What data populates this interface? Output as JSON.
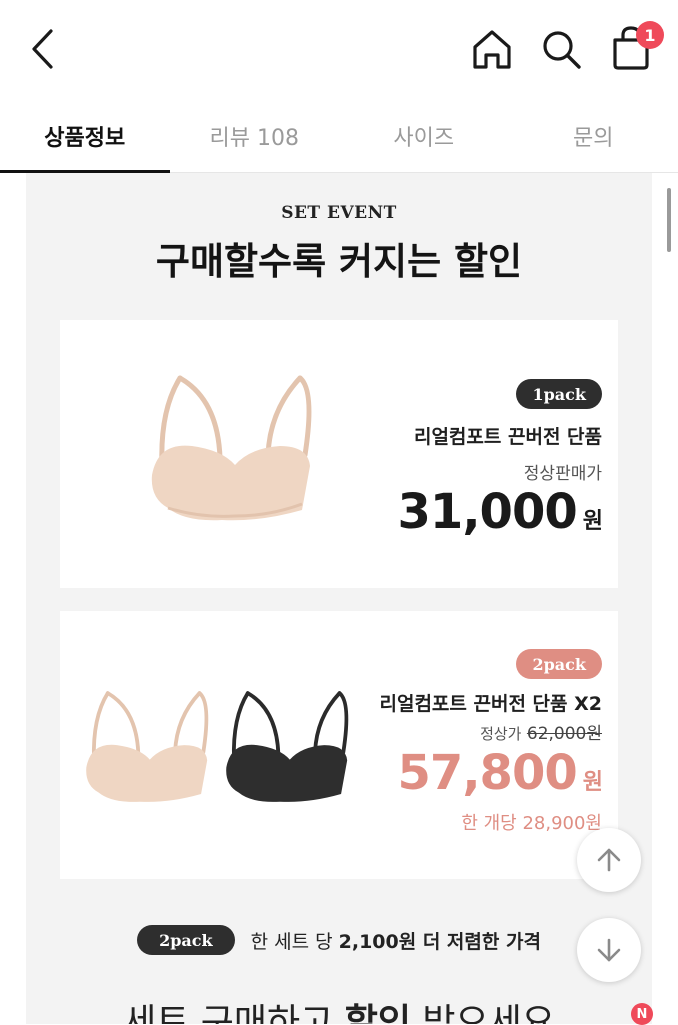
{
  "header": {
    "back_icon": "chevron-left-icon",
    "home_icon": "home-icon",
    "search_icon": "search-icon",
    "cart_icon": "shopping-bag-icon",
    "cart_count": "1"
  },
  "tabs": [
    {
      "label": "상품정보",
      "active": true
    },
    {
      "label": "리뷰 108",
      "active": false
    },
    {
      "label": "사이즈",
      "active": false
    },
    {
      "label": "문의",
      "active": false
    }
  ],
  "event": {
    "eyebrow": "SET EVENT",
    "title": "구매할수록 커지는 할인"
  },
  "cards": [
    {
      "pack": "1pack",
      "name": "리얼컴포트 끈버전 단품",
      "price_label": "정상판매가",
      "price": "31,000",
      "currency": "원",
      "colors": [
        "#efd6c3"
      ]
    },
    {
      "pack": "2pack",
      "name": "리얼컴포트 끈버전 단품 X2",
      "original_label": "정상가",
      "original_price": "62,000원",
      "price": "57,800",
      "currency": "원",
      "per_unit": "한 개당 28,900원",
      "colors": [
        "#efd6c3",
        "#2b2b2b"
      ]
    }
  ],
  "promo": {
    "pill": "2pack",
    "text_before": "한 세트 당",
    "text_bold": "2,100원 더 저렴한 가격"
  },
  "bottom_heading": {
    "before": "세트 구매하고",
    "bold": "할인",
    "after": "받으세요"
  },
  "floating": {
    "up_icon": "arrow-up-icon",
    "down_icon": "arrow-down-icon",
    "new_badge": "N"
  },
  "colors": {
    "accent_pink": "#df8e83",
    "badge_red": "#ef4a5a",
    "dark_pill": "#2e2e2e",
    "section_bg": "#f3f3f3"
  }
}
